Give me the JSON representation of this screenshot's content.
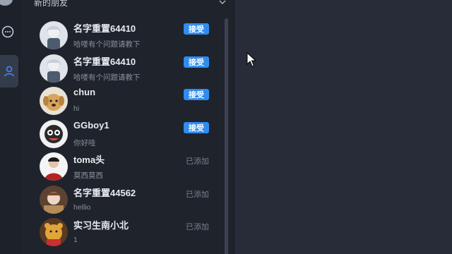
{
  "header": {
    "title": "新的朋友"
  },
  "requests": [
    {
      "name": "名字重置64410",
      "message": "哈喽有个问题请教下",
      "status": "accept",
      "avatar": "anime-avatar"
    },
    {
      "name": "名字重置64410",
      "message": "哈喽有个问题请教下",
      "status": "accept",
      "avatar": "anime-avatar"
    },
    {
      "name": "chun",
      "message": "hi",
      "status": "accept",
      "avatar": "dog-avatar"
    },
    {
      "name": "GGboy1",
      "message": "你好哇",
      "status": "accept",
      "avatar": "cartoon-avatar"
    },
    {
      "name": "toma头",
      "message": "莫西莫西",
      "status": "added",
      "avatar": "person-avatar"
    },
    {
      "name": "名字重置44562",
      "message": "hellio",
      "status": "added",
      "avatar": "anime-girl-avatar"
    },
    {
      "name": "实习生南小北",
      "message": "1",
      "status": "added",
      "avatar": "bear-avatar"
    }
  ],
  "labels": {
    "accept": "接受",
    "added": "已添加"
  },
  "colors": {
    "accent": "#2f8cf0",
    "panel_bg": "#1f232c",
    "main_bg": "#272c38"
  }
}
